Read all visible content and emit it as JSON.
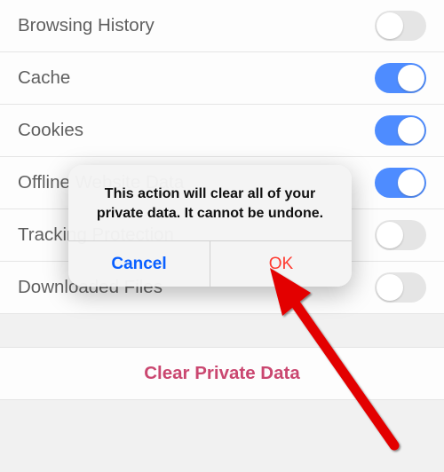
{
  "rows": [
    {
      "label": "Browsing History",
      "on": false
    },
    {
      "label": "Cache",
      "on": true
    },
    {
      "label": "Cookies",
      "on": true
    },
    {
      "label": "Offline Website Data",
      "on": true
    },
    {
      "label": "Tracking Protection",
      "on": false
    },
    {
      "label": "Downloaded Files",
      "on": false
    }
  ],
  "clear_label": "Clear Private Data",
  "dialog": {
    "message": "This action will clear all of your private data. It cannot be undone.",
    "cancel": "Cancel",
    "ok": "OK"
  }
}
